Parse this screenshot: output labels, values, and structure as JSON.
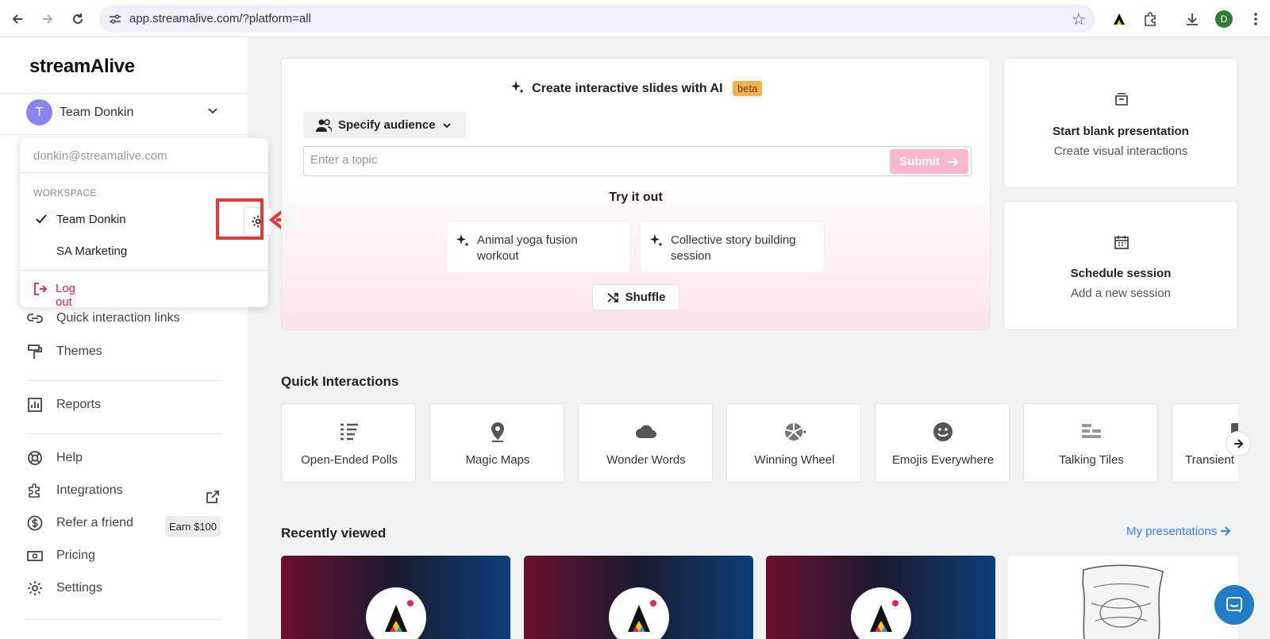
{
  "browser": {
    "url": "app.streamalive.com/?platform=all",
    "profile_initial": "D"
  },
  "sidebar": {
    "logo": "streamAlive",
    "team": {
      "initial": "T",
      "name": "Team Donkin"
    },
    "items": [
      {
        "label": "Quick interaction links",
        "icon": "link-icon"
      },
      {
        "label": "Themes",
        "icon": "paint-roller-icon"
      },
      {
        "label": "Reports",
        "icon": "chart-icon"
      },
      {
        "label": "Help",
        "icon": "lifebuoy-icon"
      },
      {
        "label": "Integrations",
        "icon": "puzzle-icon"
      },
      {
        "label": "Refer a friend",
        "icon": "dollar-icon"
      },
      {
        "label": "Pricing",
        "icon": "money-icon"
      },
      {
        "label": "Settings",
        "icon": "gear-icon"
      }
    ],
    "earn_badge": "Earn $100"
  },
  "dropdown": {
    "email": "donkin@streamalive.com",
    "section_label": "WORKSPACE",
    "workspaces": [
      "Team Donkin",
      "SA Marketing"
    ],
    "logout": "Log out"
  },
  "ai_card": {
    "title": "Create interactive slides with AI",
    "beta": "beta",
    "audience_button": "Specify audience",
    "topic_placeholder": "Enter a topic",
    "submit": "Submit",
    "try_label": "Try it out",
    "suggestions": [
      "Animal yoga fusion workout",
      "Collective story building session"
    ],
    "shuffle": "Shuffle"
  },
  "side_cards": [
    {
      "title": "Start blank presentation",
      "subtitle": "Create visual interactions"
    },
    {
      "title": "Schedule session",
      "subtitle": "Add a new session"
    }
  ],
  "quick_interactions": {
    "heading": "Quick Interactions",
    "items": [
      "Open-Ended Polls",
      "Magic Maps",
      "Wonder Words",
      "Winning Wheel",
      "Emojis Everywhere",
      "Talking Tiles",
      "Transient"
    ]
  },
  "recently_viewed": {
    "heading": "Recently viewed",
    "link": "My presentations"
  },
  "colors": {
    "accent_pink": "#d81b60",
    "submit_pink": "#f9b8cf",
    "beta_orange": "#f6b04a",
    "link_blue": "#3b82f6",
    "highlight_red": "#e53935"
  }
}
